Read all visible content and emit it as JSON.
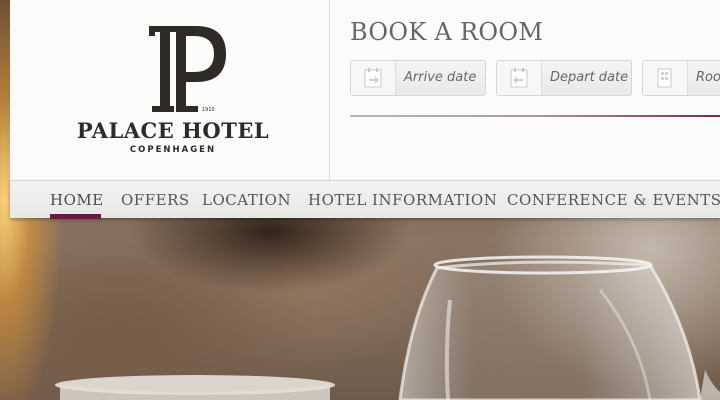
{
  "brand": {
    "name": "PALACE HOTEL",
    "city": "COPENHAGEN",
    "year": "1910"
  },
  "booking": {
    "title": "BOOK A ROOM",
    "fields": [
      {
        "label": "Arrive date",
        "icon": "calendar-arrive-icon"
      },
      {
        "label": "Depart date",
        "icon": "calendar-depart-icon"
      },
      {
        "label": "Room",
        "icon": "room-icon"
      }
    ]
  },
  "nav": {
    "items": [
      {
        "label": "HOME",
        "active": true
      },
      {
        "label": "OFFERS"
      },
      {
        "label": "LOCATION"
      },
      {
        "label": "HOTEL INFORMATION"
      },
      {
        "label": "CONFERENCE & EVENTS"
      }
    ]
  },
  "colors": {
    "accent": "#6a1a44",
    "text": "#5a5553",
    "panel": "#fbfbfa"
  }
}
